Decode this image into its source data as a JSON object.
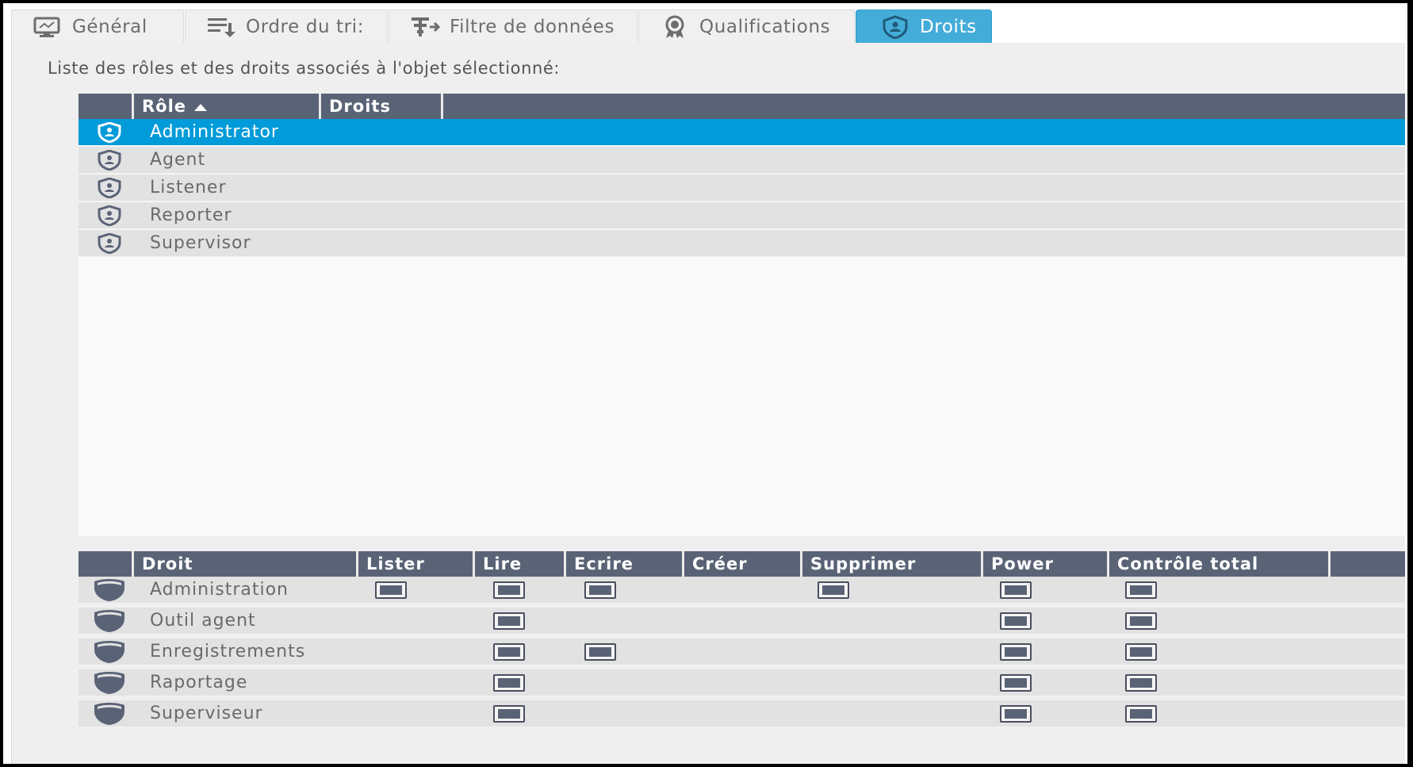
{
  "tabs": [
    {
      "label": "Général",
      "icon": "monitor-icon"
    },
    {
      "label": "Ordre du tri:",
      "icon": "sort-list-icon"
    },
    {
      "label": "Filtre de données",
      "icon": "filter-icon"
    },
    {
      "label": "Qualifications",
      "icon": "badge-icon"
    },
    {
      "label": "Droits",
      "icon": "shield-icon",
      "active": true
    }
  ],
  "caption": "Liste des rôles et des droits associés à l'objet sélectionné:",
  "roles_table": {
    "columns": [
      "Rôle",
      "Droits"
    ],
    "sort_column": "Rôle",
    "sort_direction": "ascending",
    "rows": [
      "Administrator",
      "Agent",
      "Listener",
      "Reporter",
      "Supervisor"
    ],
    "selected": "Administrator"
  },
  "rights_table": {
    "columns": [
      "Droit",
      "Lister",
      "Lire",
      "Ecrire",
      "Créer",
      "Supprimer",
      "Power",
      "Contrôle total"
    ],
    "rows": [
      {
        "name": "Administration",
        "lister": true,
        "lire": true,
        "ecrire": true,
        "creer": false,
        "supprimer": true,
        "power": true,
        "controle_total": true
      },
      {
        "name": "Outil agent",
        "lister": false,
        "lire": true,
        "ecrire": false,
        "creer": false,
        "supprimer": false,
        "power": true,
        "controle_total": true
      },
      {
        "name": "Enregistrements",
        "lister": false,
        "lire": true,
        "ecrire": true,
        "creer": false,
        "supprimer": false,
        "power": true,
        "controle_total": true
      },
      {
        "name": "Raportage",
        "lister": false,
        "lire": true,
        "ecrire": false,
        "creer": false,
        "supprimer": false,
        "power": true,
        "controle_total": true
      },
      {
        "name": "Superviseur",
        "lister": false,
        "lire": true,
        "ecrire": false,
        "creer": false,
        "supprimer": false,
        "power": true,
        "controle_total": true
      }
    ]
  },
  "colors": {
    "accent": "#009bd8",
    "active_tab": "#44acd8",
    "header": "#5a6376",
    "row": "#e2e2e2"
  }
}
